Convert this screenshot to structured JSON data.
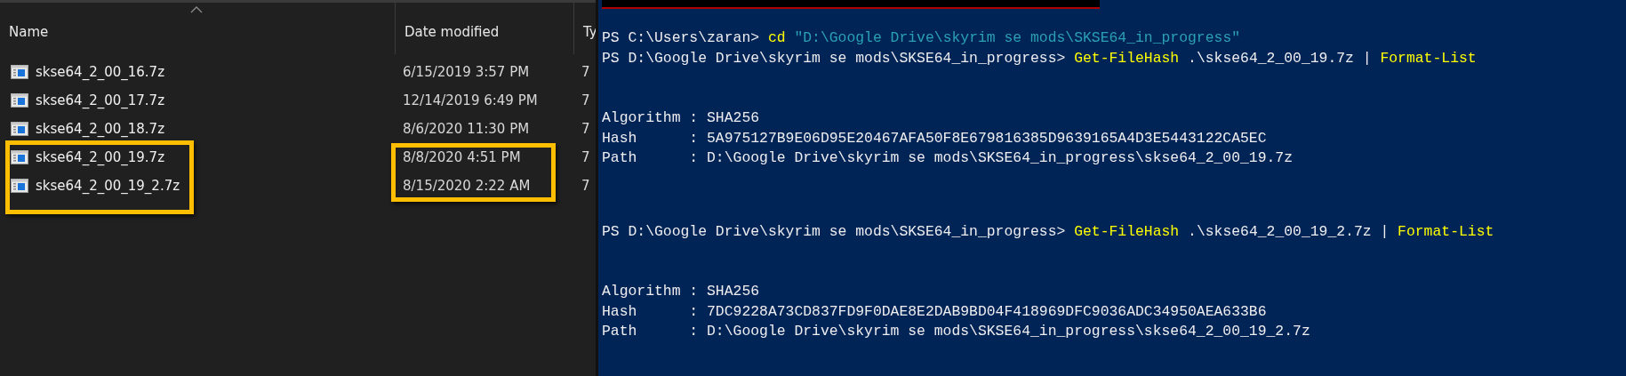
{
  "explorer": {
    "columns": [
      {
        "label": "Name"
      },
      {
        "label": "Date modified"
      },
      {
        "label": "Ty"
      }
    ],
    "row_groups": [
      {
        "highlighted": false,
        "rows": [
          {
            "name": "skse64_2_00_16.7z",
            "date": "6/15/2019 3:57 PM",
            "type": "7"
          },
          {
            "name": "skse64_2_00_17.7z",
            "date": "12/14/2019 6:49 PM",
            "type": "7"
          },
          {
            "name": "skse64_2_00_18.7z",
            "date": "8/6/2020 11:30 PM",
            "type": "7"
          }
        ]
      },
      {
        "highlighted": true,
        "rows": [
          {
            "name": "skse64_2_00_19.7z",
            "date": "8/8/2020 4:51 PM",
            "type": "7"
          },
          {
            "name": "skse64_2_00_19_2.7z",
            "date": "8/15/2020 2:22 AM",
            "type": "7"
          }
        ]
      }
    ]
  },
  "console": {
    "entries": [
      {
        "lines": [
          [
            {
              "kind": "plain",
              "text": "PS C:\\Users\\zaran> "
            },
            {
              "kind": "command",
              "text": "cd"
            },
            {
              "kind": "string",
              "text": " \"D:\\Google Drive\\skyrim se mods\\SKSE64_in_progress\""
            }
          ],
          [
            {
              "kind": "plain",
              "text": "PS D:\\Google Drive\\skyrim se mods\\SKSE64_in_progress> "
            },
            {
              "kind": "command",
              "text": "Get-FileHash"
            },
            {
              "kind": "plain",
              "text": " .\\skse64_2_00_19.7z | "
            },
            {
              "kind": "command",
              "text": "Format-List"
            }
          ]
        ],
        "output": [
          "Algorithm : SHA256",
          "Hash      : 5A975127B9E06D95E20467AFA50F8E679816385D9639165A4D3E5443122CA5EC",
          "Path      : D:\\Google Drive\\skyrim se mods\\SKSE64_in_progress\\skse64_2_00_19.7z"
        ]
      },
      {
        "lines": [
          [
            {
              "kind": "plain",
              "text": "PS D:\\Google Drive\\skyrim se mods\\SKSE64_in_progress> "
            },
            {
              "kind": "command",
              "text": "Get-FileHash"
            },
            {
              "kind": "plain",
              "text": " .\\skse64_2_00_19_2.7z | "
            },
            {
              "kind": "command",
              "text": "Format-List"
            }
          ]
        ],
        "output": [
          "Algorithm : SHA256",
          "Hash      : 7DC9228A73CD837FD9F0DAE8E2DAB9BD04F418969DFC9036ADC34950AEA633B6",
          "Path      : D:\\Google Drive\\skyrim se mods\\SKSE64_in_progress\\skse64_2_00_19_2.7z"
        ]
      }
    ]
  }
}
